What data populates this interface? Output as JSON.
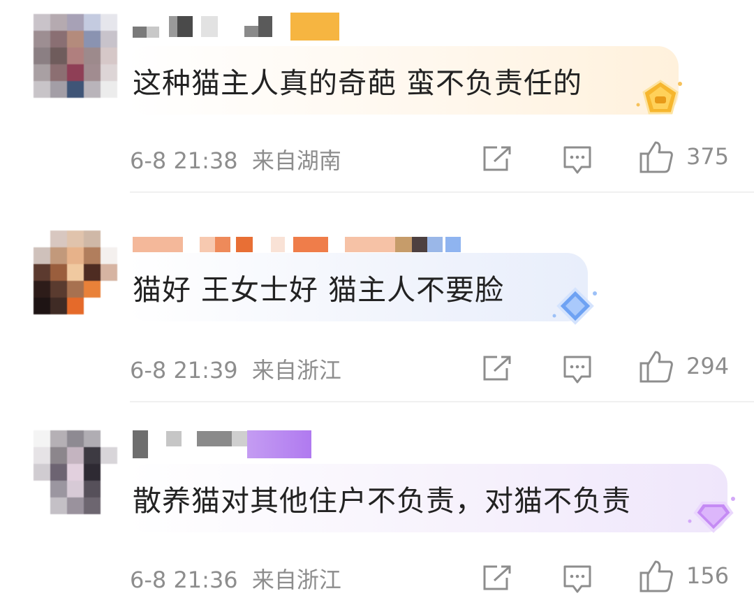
{
  "comments": [
    {
      "text": "这种猫主人真的奇葩 蛮不负责任的",
      "time": "6-8 21:38",
      "location": "来自湖南",
      "likes": "375",
      "badge": "gold-crown-badge-icon",
      "bubble_color": "#fff6ea"
    },
    {
      "text": "猫好 王女士好 猫主人不要脸",
      "time": "6-8 21:39",
      "location": "来自浙江",
      "likes": "294",
      "badge": "blue-diamond-badge-icon",
      "bubble_color": "#eef2fc"
    },
    {
      "text": "散养猫对其他住户不负责，对猫不负责",
      "time": "6-8 21:36",
      "location": "来自浙江",
      "likes": "156",
      "badge": "purple-diamond-badge-icon",
      "bubble_color": "#f4effb"
    }
  ],
  "icons": {
    "share": "share-icon",
    "reply": "comment-icon",
    "like": "thumbs-up-icon"
  }
}
